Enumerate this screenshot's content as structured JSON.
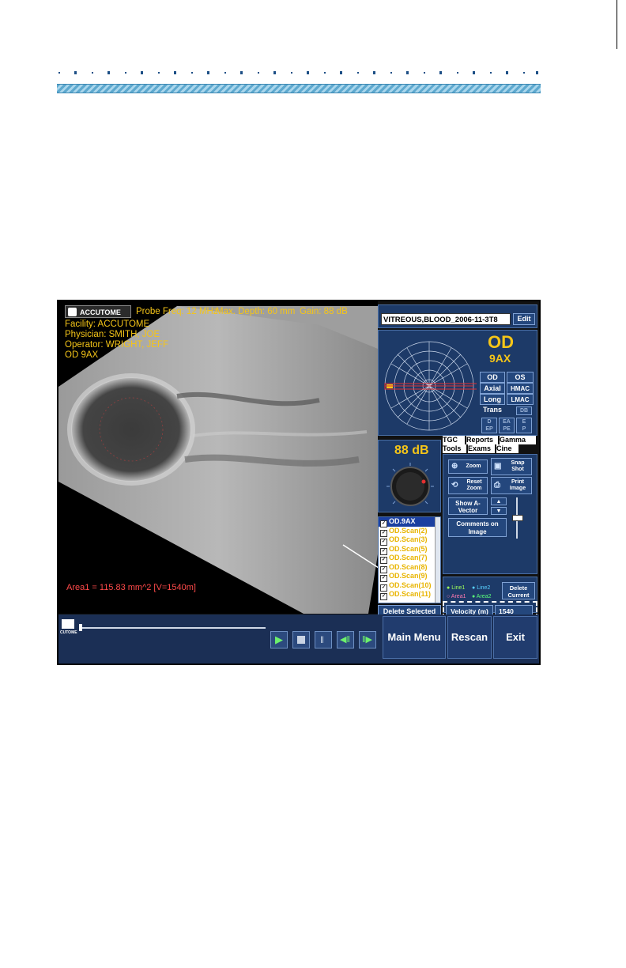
{
  "hud": {
    "logo": "ACCUTOME",
    "probe_freq": "Probe Freq: 12 MHz",
    "max_depth": "Max. Depth: 60 mm",
    "gain": "Gain: 88 dB",
    "facility": "Facility: ACCUTOME",
    "physician": "Physician: SMITH, JOE",
    "operator": "Operator: WRIGHT, JEFF",
    "eye_scan": "OD  9AX",
    "area_measure": "Area1 = 115.83 mm^2 [V=1540m]"
  },
  "protocol": {
    "select_value": "VITREOUS,BLOOD_2006-11-3T8",
    "edit_label": "Edit"
  },
  "probe_position": {
    "eye": "OD",
    "position": "9AX",
    "labels": [
      "OD",
      "OS",
      "Axial",
      "HMAC",
      "Long",
      "LMAC",
      "Trans",
      "DB"
    ],
    "sub_labels": [
      "D",
      "EA",
      "E",
      "EP",
      "PE",
      "P"
    ]
  },
  "gain_panel": {
    "value": "88 dB"
  },
  "scan_list": {
    "items": [
      "OD.9AX",
      "OD.Scan(2)",
      "OD.Scan(3)",
      "OD.Scan(5)",
      "OD.Scan(7)",
      "OD.Scan(8)",
      "OD.Scan(9)",
      "OD.Scan(10)",
      "OD.Scan(11)"
    ],
    "delete_selected": "Delete Selected"
  },
  "tabs": {
    "row1": [
      "TGC",
      "Reports",
      "Gamma"
    ],
    "row2": [
      "Tools",
      "Exams",
      "Cine"
    ]
  },
  "tools": {
    "zoom": "Zoom",
    "snap_shot": "Snap Shot",
    "reset_zoom": "Reset Zoom",
    "print_image": "Print Image",
    "show_a_vector": "Show A-Vector",
    "comments_on_image": "Comments on Image"
  },
  "measure": {
    "line1": "Line1",
    "line2": "Line2",
    "area1": "Area1",
    "area2": "Area2",
    "delete_current": "Delete Current",
    "velocity_label": "Velocity (m)",
    "velocity_value": "1540"
  },
  "bottom": {
    "main_menu": "Main Menu",
    "rescan": "Rescan",
    "exit": "Exit",
    "logo_text": "CUTOME"
  },
  "colors": {
    "hud_text": "#f5c518",
    "panel_bg": "#1d3a68",
    "area_text": "#ff4a4a"
  }
}
